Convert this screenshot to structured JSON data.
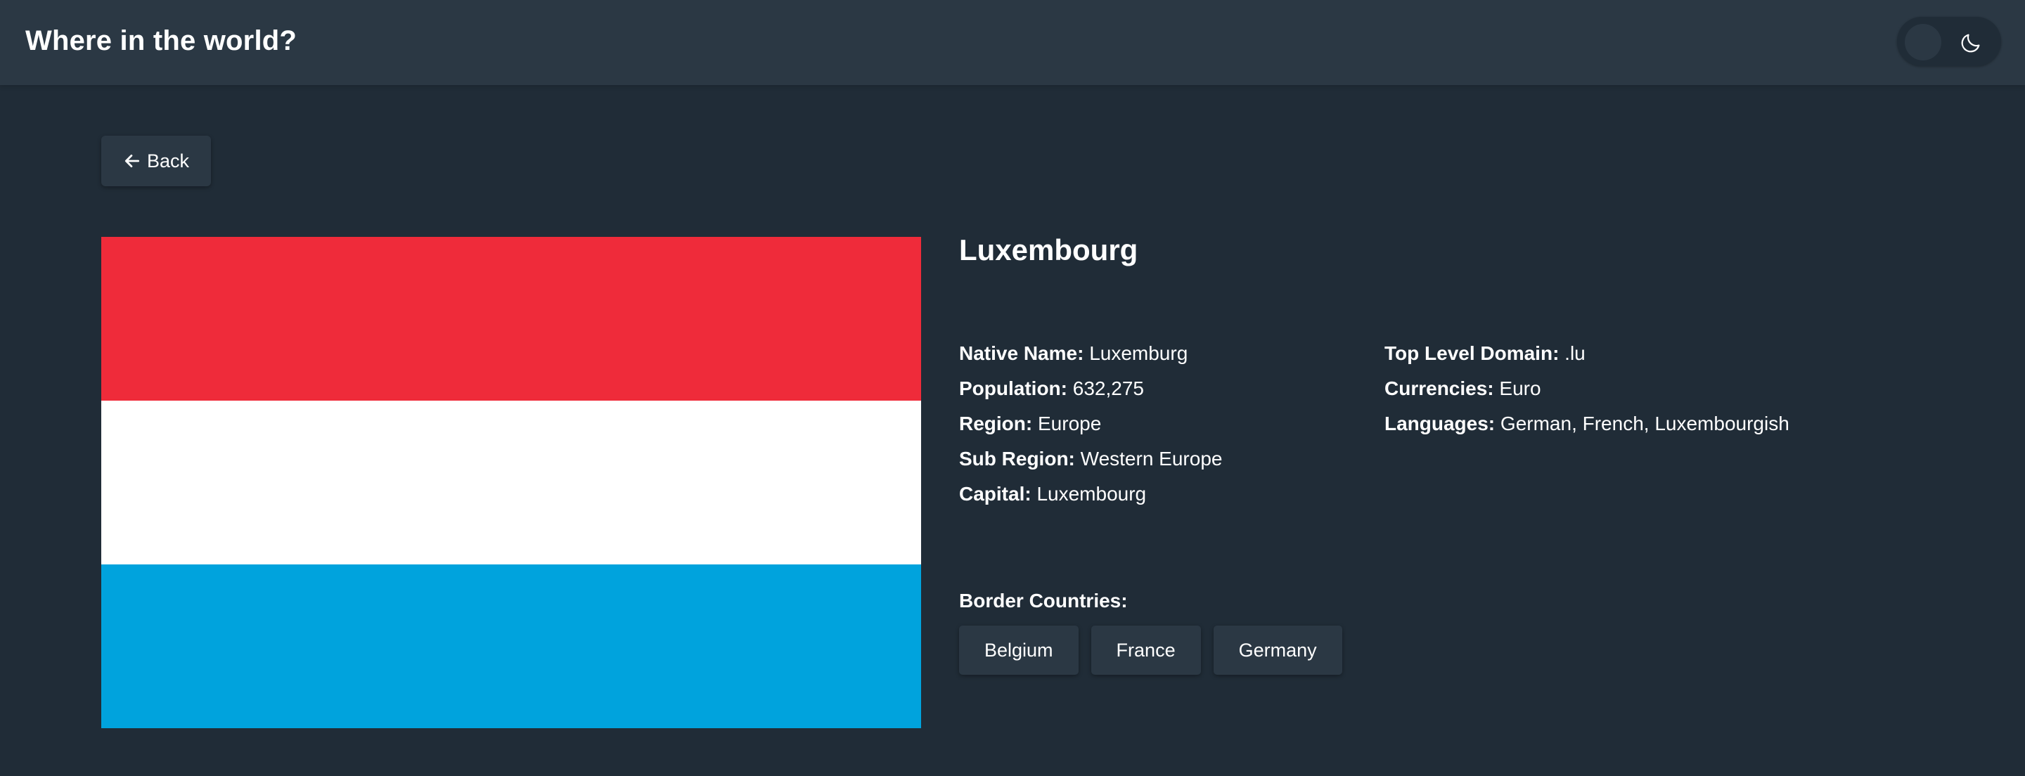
{
  "header": {
    "title": "Where in the world?",
    "theme_toggle_icon": "moon-icon"
  },
  "back_button": {
    "label": "Back",
    "icon": "arrow-left-icon"
  },
  "flag": {
    "stripe_colors": [
      "#ef2b3a",
      "#ffffff",
      "#00a3dd"
    ]
  },
  "country": {
    "name": "Luxembourg",
    "left_details": [
      {
        "label": "Native Name:",
        "value": "Luxemburg"
      },
      {
        "label": "Population:",
        "value": "632,275"
      },
      {
        "label": "Region:",
        "value": "Europe"
      },
      {
        "label": "Sub Region:",
        "value": "Western Europe"
      },
      {
        "label": "Capital:",
        "value": "Luxembourg"
      }
    ],
    "right_details": [
      {
        "label": "Top Level Domain:",
        "value": ".lu"
      },
      {
        "label": "Currencies:",
        "value": "Euro"
      },
      {
        "label": "Languages:",
        "value": "German, French, Luxembourgish"
      }
    ],
    "border_title": "Border Countries:",
    "borders": [
      "Belgium",
      "France",
      "Germany"
    ]
  },
  "colors": {
    "background": "#202c37",
    "element": "#2b3844",
    "text": "#ffffff"
  }
}
